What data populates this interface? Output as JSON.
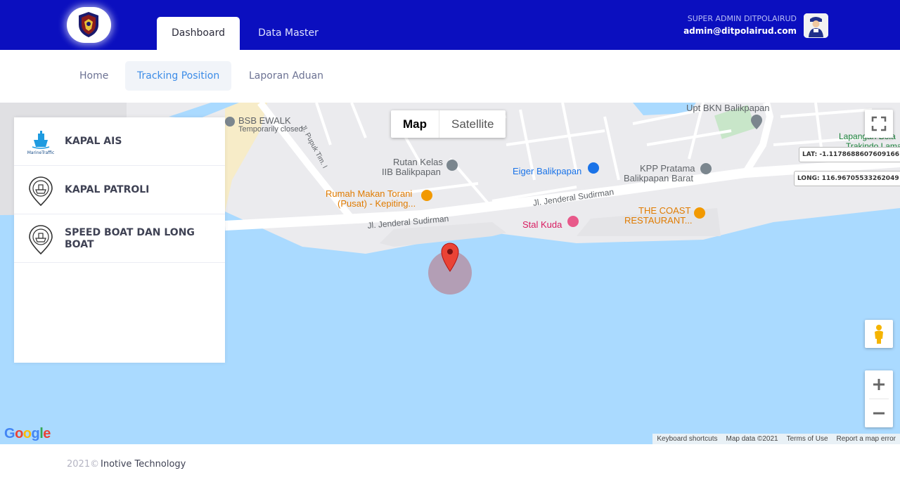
{
  "header": {
    "tabs": [
      {
        "label": "Dashboard",
        "active": true
      },
      {
        "label": "Data Master",
        "active": false
      }
    ],
    "user_role": "SUPER ADMIN DITPOLAIRUD",
    "user_email": "admin@ditpolairud.com",
    "brand_color": "#0b0fbf"
  },
  "subnav": {
    "items": [
      {
        "label": "Home",
        "active": false
      },
      {
        "label": "Tracking Position",
        "active": true
      },
      {
        "label": "Laporan Aduan",
        "active": false
      }
    ]
  },
  "panel": {
    "items": [
      {
        "label": "KAPAL AIS",
        "icon": "marinetraffic-icon",
        "icon_caption": "MarineTraffic"
      },
      {
        "label": "KAPAL PATROLI",
        "icon": "ship-pin-icon"
      },
      {
        "label": "SPEED BOAT DAN LONG BOAT",
        "icon": "ship-pin-icon"
      }
    ]
  },
  "map": {
    "type_toggle": {
      "map": "Map",
      "satellite": "Satellite",
      "selected": "Map"
    },
    "lat_label": "LAT: -1.1178688607609166",
    "long_label": "LONG: 116.96705533262049",
    "places": {
      "bsb_ewalk": "BSB EWALK",
      "bsb_status": "Temporarily closed",
      "pupuk": "Jl. Pupuk Tim. I",
      "upt_bkn": "Upt BKN Balikpapan",
      "lapangan": "Lapangan Bola",
      "trakindo": "Trakindo Lama",
      "rutan_1": "Rutan Kelas",
      "rutan_2": "IIB Balikpapan",
      "eiger": "Eiger Balikpapan",
      "kpp_1": "KPP Pratama",
      "kpp_2": "Balikpapan Barat",
      "rumah_makan_1": "Rumah Makan Torani",
      "rumah_makan_2": "(Pusat) - Kepiting...",
      "sudirman": "Jl. Jenderal Sudirman",
      "coast_1": "THE COAST",
      "coast_2": "RESTAURANT...",
      "stal_kuda": "Stal Kuda"
    },
    "attribution": [
      "Keyboard shortcuts",
      "Map data ©2021",
      "Terms of Use",
      "Report a map error"
    ],
    "water_color": "#aadaff",
    "marker_color": "#ea4335"
  },
  "footer": {
    "year": "2021©",
    "company": "Inotive Technology"
  }
}
